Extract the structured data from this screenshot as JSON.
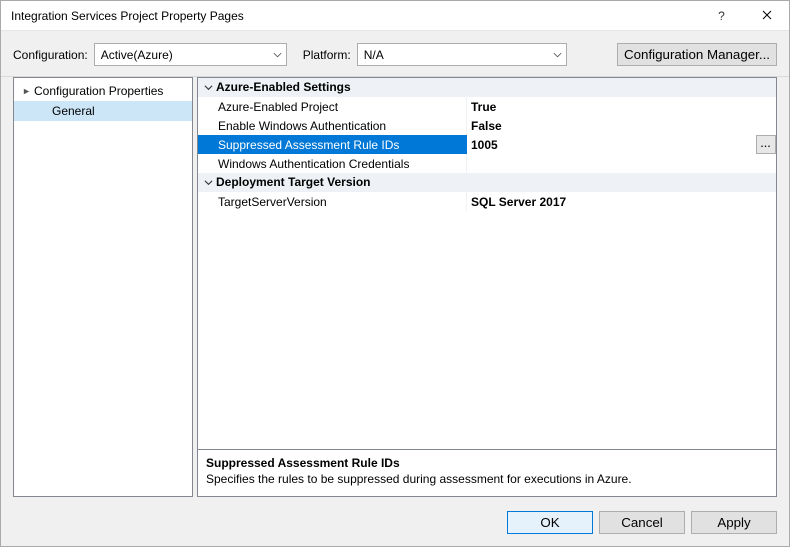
{
  "window": {
    "title": "Integration Services Project Property Pages"
  },
  "titlebar": {
    "help": "?",
    "close": "✕"
  },
  "toolbar": {
    "configuration_label": "Configuration:",
    "configuration_value": "Active(Azure)",
    "platform_label": "Platform:",
    "platform_value": "N/A",
    "config_manager_label": "Configuration Manager..."
  },
  "tree": {
    "root": "Configuration Properties",
    "child": "General"
  },
  "grid": {
    "category1": "Azure-Enabled Settings",
    "p1_name": "Azure-Enabled Project",
    "p1_val": "True",
    "p2_name": "Enable Windows Authentication",
    "p2_val": "False",
    "p3_name": "Suppressed Assessment Rule IDs",
    "p3_val": "1005",
    "p4_name": "Windows Authentication Credentials",
    "p4_val": "",
    "category2": "Deployment Target Version",
    "p5_name": "TargetServerVersion",
    "p5_val": "SQL Server 2017"
  },
  "description": {
    "title": "Suppressed Assessment Rule IDs",
    "text": "Specifies the rules to be suppressed during assessment for executions in Azure."
  },
  "footer": {
    "ok": "OK",
    "cancel": "Cancel",
    "apply": "Apply"
  },
  "ellipsis": "..."
}
